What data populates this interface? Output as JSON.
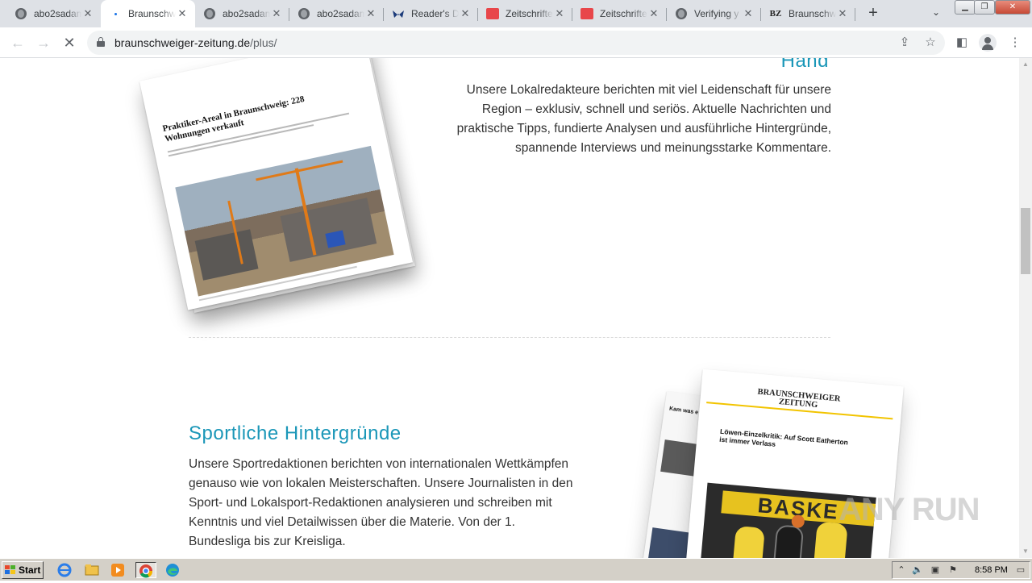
{
  "browser": {
    "tabs": [
      {
        "title": "abo2sadam",
        "icon": "globe-icon",
        "active": false
      },
      {
        "title": "Braunschweig",
        "icon": "loading-dot-icon",
        "active": true
      },
      {
        "title": "abo2sadam",
        "icon": "globe-icon",
        "active": false
      },
      {
        "title": "abo2sadam",
        "icon": "globe-icon",
        "active": false
      },
      {
        "title": "Reader's Di",
        "icon": "readers-digest-icon",
        "active": false
      },
      {
        "title": "Zeitschriften",
        "icon": "zeitschriften-icon",
        "active": false
      },
      {
        "title": "Zeitschriften",
        "icon": "zeitschriften-icon",
        "active": false
      },
      {
        "title": "Verifying y",
        "icon": "globe-icon",
        "active": false
      },
      {
        "title": "Braunschw",
        "icon": "bz-icon",
        "active": false
      }
    ],
    "new_tab_glyph": "+",
    "url_domain": "braunschweiger-zeitung.de",
    "url_path": "/plus/"
  },
  "content": {
    "section1_heading_tail": "Hand",
    "section1_text": "Unsere Lokalredakteure berichten mit viel Leidenschaft für unsere Region – exklusiv, schnell und seriös. Aktuelle Nachrichten und praktische Tipps, fundierte Analysen und ausführliche Hintergründe, spannende Interviews und meinungsstarke Kommentare.",
    "section2_heading": "Sportliche Hintergründe",
    "section2_text": "Unsere Sportredaktionen berichten von internationalen Wettkämpfen genauso wie von lokalen Meisterschaften. Unsere Journalisten in den Sport- und Lokalsport-Redaktionen analysieren und schreiben mit Kenntnis und viel Detailwissen über die Materie. Von der 1. Bundesliga bis zur Kreisliga.",
    "mock1_headline": "Praktiker-Areal in Braunschweig: 228 Wohnungen verkauft",
    "mock2_masthead_line1": "BRAUNSCHWEIGER",
    "mock2_masthead_line2": "ZEITUNG",
    "mock2_headline": "Löwen-Einzelkritik: Auf Scott Eatherton ist immer Verlass",
    "mock2_photo_banner": "BASKE",
    "mock2_side_headline": "Kam was e"
  },
  "watermark": "ANY RUN",
  "taskbar": {
    "start_label": "Start",
    "clock": "8:58 PM"
  },
  "colors": {
    "accent": "#1b97b8",
    "text": "#333333",
    "tabstrip": "#dee1e6"
  }
}
